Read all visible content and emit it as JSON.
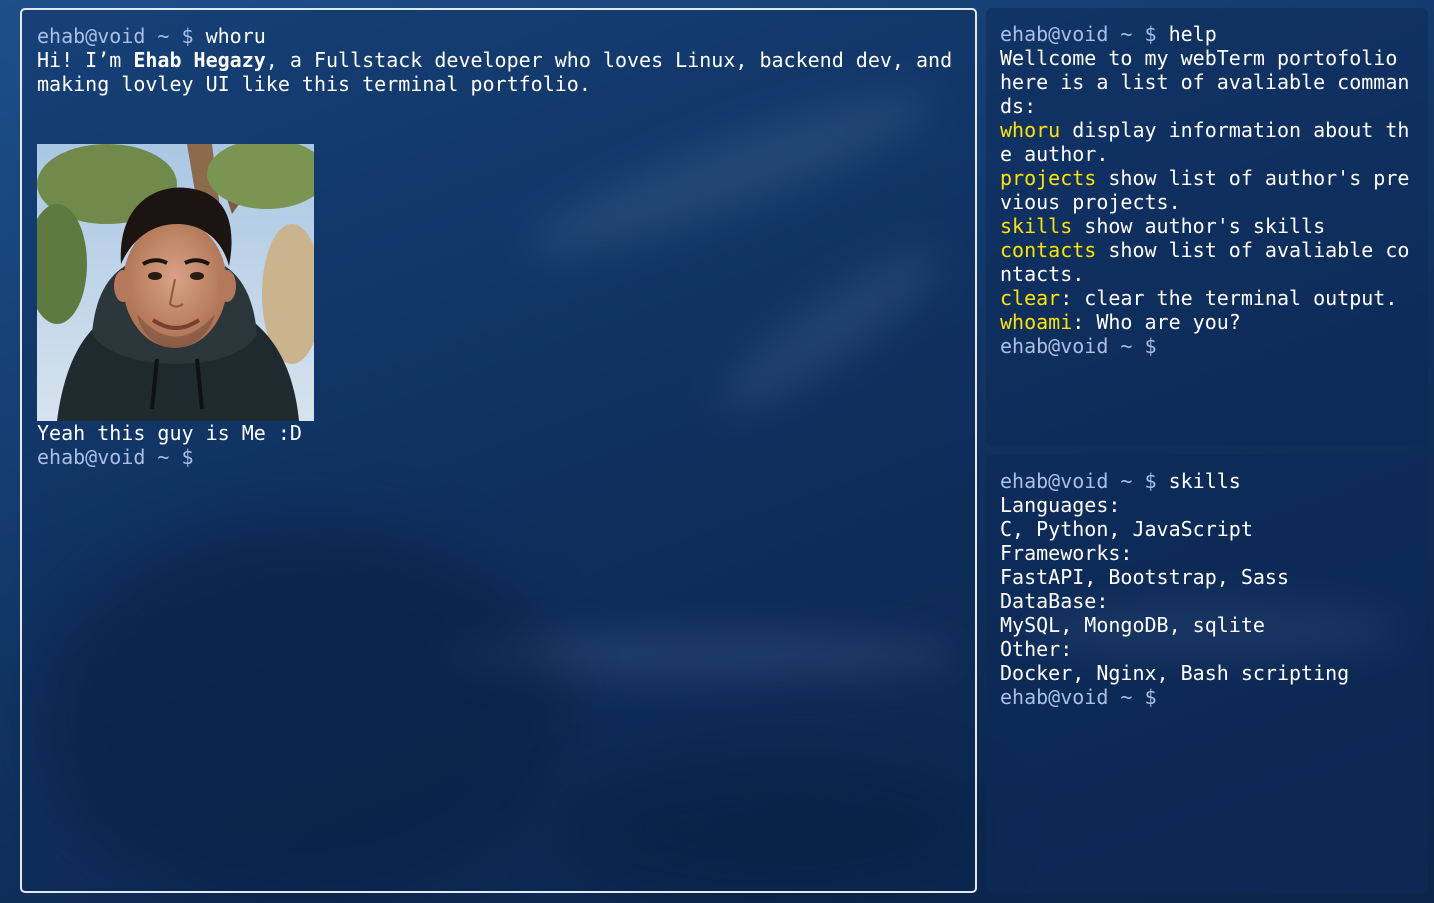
{
  "main_terminal": {
    "prompt": "ehab@void ~ $",
    "command": "whoru",
    "intro_prefix": "Hi! I’m ",
    "intro_name": "Ehab Hegazy",
    "intro_rest": ", a Fullstack developer who loves Linux, backend dev, and making lovley UI like this terminal portfolio.",
    "photo_caption": "Yeah this guy is Me :D",
    "final_prompt": "ehab@void ~ $"
  },
  "help_terminal": {
    "prompt": "ehab@void ~ $",
    "command": "help",
    "welcome": "Wellcome to my webTerm portofolio here is a list of avaliable commands:",
    "commands": [
      {
        "name": "whoru",
        "desc": " display information about the author."
      },
      {
        "name": "projects",
        "desc": " show list of author's previous projects."
      },
      {
        "name": "skills",
        "desc": " show author's skills"
      },
      {
        "name": "contacts",
        "desc": " show list of avaliable contacts."
      },
      {
        "name": "clear",
        "desc": ": clear the terminal output."
      },
      {
        "name": "whoami",
        "desc": ": Who are you?"
      }
    ],
    "final_prompt": "ehab@void ~ $"
  },
  "skills_terminal": {
    "prompt": "ehab@void ~ $",
    "command": "skills",
    "lines": [
      "Languages:",
      "C, Python, JavaScript",
      "Frameworks:",
      "FastAPI, Bootstrap, Sass",
      "DataBase:",
      "MySQL, MongoDB, sqlite",
      "Other:",
      "Docker, Nginx, Bash scripting"
    ],
    "final_prompt": "ehab@void ~ $"
  },
  "colors": {
    "prompt": "#a9bfe6",
    "command_highlight": "#ffe300",
    "text": "#ffffff",
    "main_border": "#dfe8f3"
  },
  "icons": {
    "profile_photo": "avatar"
  }
}
